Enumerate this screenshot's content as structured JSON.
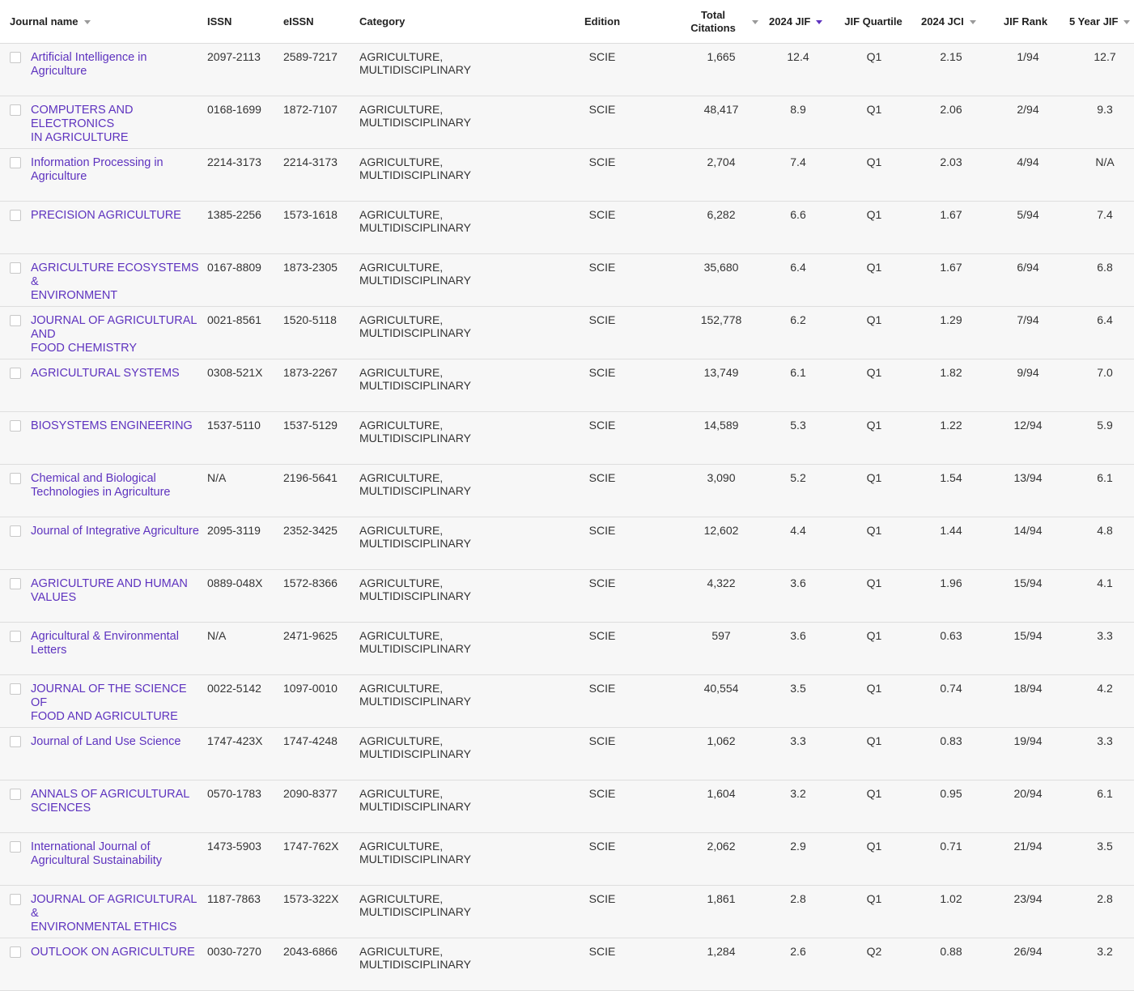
{
  "headers": {
    "journal_name": "Journal name",
    "issn": "ISSN",
    "eissn": "eISSN",
    "category": "Category",
    "edition": "Edition",
    "total_citations_line1": "Total",
    "total_citations_line2": "Citations",
    "jif": "2024 JIF",
    "jif_quartile": "JIF Quartile",
    "jci": "2024 JCI",
    "jif_rank": "JIF Rank",
    "five_year_jif": "5 Year JIF"
  },
  "sort": {
    "column": "2024 JIF",
    "accent_color": "#5e33bf",
    "caret_icon": "caret-down-icon"
  },
  "rows": [
    {
      "name_line1": "Artificial Intelligence in",
      "name_line2": "Agriculture",
      "issn": "2097-2113",
      "eissn": "2589-7217",
      "category_line1": "AGRICULTURE,",
      "category_line2": "MULTIDISCIPLINARY",
      "edition": "SCIE",
      "citations": "1,665",
      "jif": "12.4",
      "quartile": "Q1",
      "jci": "2.15",
      "rank": "1/94",
      "jif5": "12.7"
    },
    {
      "name_line1": "COMPUTERS AND ELECTRONICS",
      "name_line2": "IN AGRICULTURE",
      "issn": "0168-1699",
      "eissn": "1872-7107",
      "category_line1": "AGRICULTURE,",
      "category_line2": "MULTIDISCIPLINARY",
      "edition": "SCIE",
      "citations": "48,417",
      "jif": "8.9",
      "quartile": "Q1",
      "jci": "2.06",
      "rank": "2/94",
      "jif5": "9.3"
    },
    {
      "name_line1": "Information Processing in",
      "name_line2": "Agriculture",
      "issn": "2214-3173",
      "eissn": "2214-3173",
      "category_line1": "AGRICULTURE,",
      "category_line2": "MULTIDISCIPLINARY",
      "edition": "SCIE",
      "citations": "2,704",
      "jif": "7.4",
      "quartile": "Q1",
      "jci": "2.03",
      "rank": "4/94",
      "jif5": "N/A"
    },
    {
      "name_line1": "PRECISION AGRICULTURE",
      "name_line2": "",
      "issn": "1385-2256",
      "eissn": "1573-1618",
      "category_line1": "AGRICULTURE,",
      "category_line2": "MULTIDISCIPLINARY",
      "edition": "SCIE",
      "citations": "6,282",
      "jif": "6.6",
      "quartile": "Q1",
      "jci": "1.67",
      "rank": "5/94",
      "jif5": "7.4"
    },
    {
      "name_line1": "AGRICULTURE ECOSYSTEMS &",
      "name_line2": "ENVIRONMENT",
      "issn": "0167-8809",
      "eissn": "1873-2305",
      "category_line1": "AGRICULTURE,",
      "category_line2": "MULTIDISCIPLINARY",
      "edition": "SCIE",
      "citations": "35,680",
      "jif": "6.4",
      "quartile": "Q1",
      "jci": "1.67",
      "rank": "6/94",
      "jif5": "6.8"
    },
    {
      "name_line1": "JOURNAL OF AGRICULTURAL AND",
      "name_line2": "FOOD CHEMISTRY",
      "issn": "0021-8561",
      "eissn": "1520-5118",
      "category_line1": "AGRICULTURE,",
      "category_line2": "MULTIDISCIPLINARY",
      "edition": "SCIE",
      "citations": "152,778",
      "jif": "6.2",
      "quartile": "Q1",
      "jci": "1.29",
      "rank": "7/94",
      "jif5": "6.4"
    },
    {
      "name_line1": "AGRICULTURAL SYSTEMS",
      "name_line2": "",
      "issn": "0308-521X",
      "eissn": "1873-2267",
      "category_line1": "AGRICULTURE,",
      "category_line2": "MULTIDISCIPLINARY",
      "edition": "SCIE",
      "citations": "13,749",
      "jif": "6.1",
      "quartile": "Q1",
      "jci": "1.82",
      "rank": "9/94",
      "jif5": "7.0"
    },
    {
      "name_line1": "BIOSYSTEMS ENGINEERING",
      "name_line2": "",
      "issn": "1537-5110",
      "eissn": "1537-5129",
      "category_line1": "AGRICULTURE,",
      "category_line2": "MULTIDISCIPLINARY",
      "edition": "SCIE",
      "citations": "14,589",
      "jif": "5.3",
      "quartile": "Q1",
      "jci": "1.22",
      "rank": "12/94",
      "jif5": "5.9"
    },
    {
      "name_line1": "Chemical and Biological",
      "name_line2": "Technologies in Agriculture",
      "issn": "N/A",
      "eissn": "2196-5641",
      "category_line1": "AGRICULTURE,",
      "category_line2": "MULTIDISCIPLINARY",
      "edition": "SCIE",
      "citations": "3,090",
      "jif": "5.2",
      "quartile": "Q1",
      "jci": "1.54",
      "rank": "13/94",
      "jif5": "6.1"
    },
    {
      "name_line1": "Journal of Integrative Agriculture",
      "name_line2": "",
      "issn": "2095-3119",
      "eissn": "2352-3425",
      "category_line1": "AGRICULTURE,",
      "category_line2": "MULTIDISCIPLINARY",
      "edition": "SCIE",
      "citations": "12,602",
      "jif": "4.4",
      "quartile": "Q1",
      "jci": "1.44",
      "rank": "14/94",
      "jif5": "4.8"
    },
    {
      "name_line1": "AGRICULTURE AND HUMAN",
      "name_line2": "VALUES",
      "issn": "0889-048X",
      "eissn": "1572-8366",
      "category_line1": "AGRICULTURE,",
      "category_line2": "MULTIDISCIPLINARY",
      "edition": "SCIE",
      "citations": "4,322",
      "jif": "3.6",
      "quartile": "Q1",
      "jci": "1.96",
      "rank": "15/94",
      "jif5": "4.1"
    },
    {
      "name_line1": "Agricultural & Environmental",
      "name_line2": "Letters",
      "issn": "N/A",
      "eissn": "2471-9625",
      "category_line1": "AGRICULTURE,",
      "category_line2": "MULTIDISCIPLINARY",
      "edition": "SCIE",
      "citations": "597",
      "jif": "3.6",
      "quartile": "Q1",
      "jci": "0.63",
      "rank": "15/94",
      "jif5": "3.3"
    },
    {
      "name_line1": "JOURNAL OF THE SCIENCE OF",
      "name_line2": "FOOD AND AGRICULTURE",
      "issn": "0022-5142",
      "eissn": "1097-0010",
      "category_line1": "AGRICULTURE,",
      "category_line2": "MULTIDISCIPLINARY",
      "edition": "SCIE",
      "citations": "40,554",
      "jif": "3.5",
      "quartile": "Q1",
      "jci": "0.74",
      "rank": "18/94",
      "jif5": "4.2"
    },
    {
      "name_line1": "Journal of Land Use Science",
      "name_line2": "",
      "issn": "1747-423X",
      "eissn": "1747-4248",
      "category_line1": "AGRICULTURE,",
      "category_line2": "MULTIDISCIPLINARY",
      "edition": "SCIE",
      "citations": "1,062",
      "jif": "3.3",
      "quartile": "Q1",
      "jci": "0.83",
      "rank": "19/94",
      "jif5": "3.3"
    },
    {
      "name_line1": "ANNALS OF AGRICULTURAL",
      "name_line2": "SCIENCES",
      "issn": "0570-1783",
      "eissn": "2090-8377",
      "category_line1": "AGRICULTURE,",
      "category_line2": "MULTIDISCIPLINARY",
      "edition": "SCIE",
      "citations": "1,604",
      "jif": "3.2",
      "quartile": "Q1",
      "jci": "0.95",
      "rank": "20/94",
      "jif5": "6.1"
    },
    {
      "name_line1": "International Journal of",
      "name_line2": "Agricultural Sustainability",
      "issn": "1473-5903",
      "eissn": "1747-762X",
      "category_line1": "AGRICULTURE,",
      "category_line2": "MULTIDISCIPLINARY",
      "edition": "SCIE",
      "citations": "2,062",
      "jif": "2.9",
      "quartile": "Q1",
      "jci": "0.71",
      "rank": "21/94",
      "jif5": "3.5"
    },
    {
      "name_line1": "JOURNAL OF AGRICULTURAL &",
      "name_line2": "ENVIRONMENTAL ETHICS",
      "issn": "1187-7863",
      "eissn": "1573-322X",
      "category_line1": "AGRICULTURE,",
      "category_line2": "MULTIDISCIPLINARY",
      "edition": "SCIE",
      "citations": "1,861",
      "jif": "2.8",
      "quartile": "Q1",
      "jci": "1.02",
      "rank": "23/94",
      "jif5": "2.8"
    },
    {
      "name_line1": "OUTLOOK ON AGRICULTURE",
      "name_line2": "",
      "issn": "0030-7270",
      "eissn": "2043-6866",
      "category_line1": "AGRICULTURE,",
      "category_line2": "MULTIDISCIPLINARY",
      "edition": "SCIE",
      "citations": "1,284",
      "jif": "2.6",
      "quartile": "Q2",
      "jci": "0.88",
      "rank": "26/94",
      "jif5": "3.2"
    }
  ]
}
